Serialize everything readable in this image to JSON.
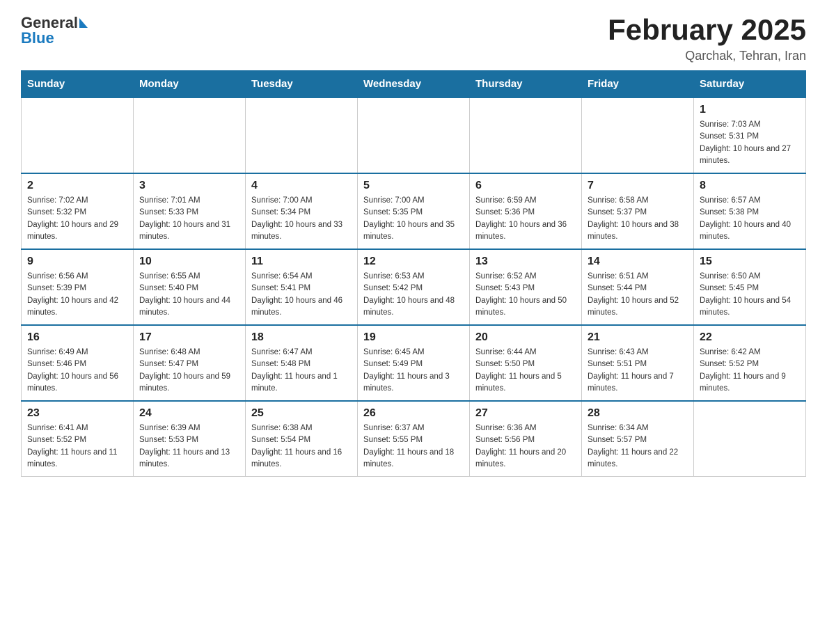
{
  "header": {
    "logo_general": "General",
    "logo_blue": "Blue",
    "month_title": "February 2025",
    "location": "Qarchak, Tehran, Iran"
  },
  "days_of_week": [
    "Sunday",
    "Monday",
    "Tuesday",
    "Wednesday",
    "Thursday",
    "Friday",
    "Saturday"
  ],
  "weeks": [
    {
      "days": [
        {
          "date": "",
          "sunrise": "",
          "sunset": "",
          "daylight": ""
        },
        {
          "date": "",
          "sunrise": "",
          "sunset": "",
          "daylight": ""
        },
        {
          "date": "",
          "sunrise": "",
          "sunset": "",
          "daylight": ""
        },
        {
          "date": "",
          "sunrise": "",
          "sunset": "",
          "daylight": ""
        },
        {
          "date": "",
          "sunrise": "",
          "sunset": "",
          "daylight": ""
        },
        {
          "date": "",
          "sunrise": "",
          "sunset": "",
          "daylight": ""
        },
        {
          "date": "1",
          "sunrise": "Sunrise: 7:03 AM",
          "sunset": "Sunset: 5:31 PM",
          "daylight": "Daylight: 10 hours and 27 minutes."
        }
      ]
    },
    {
      "days": [
        {
          "date": "2",
          "sunrise": "Sunrise: 7:02 AM",
          "sunset": "Sunset: 5:32 PM",
          "daylight": "Daylight: 10 hours and 29 minutes."
        },
        {
          "date": "3",
          "sunrise": "Sunrise: 7:01 AM",
          "sunset": "Sunset: 5:33 PM",
          "daylight": "Daylight: 10 hours and 31 minutes."
        },
        {
          "date": "4",
          "sunrise": "Sunrise: 7:00 AM",
          "sunset": "Sunset: 5:34 PM",
          "daylight": "Daylight: 10 hours and 33 minutes."
        },
        {
          "date": "5",
          "sunrise": "Sunrise: 7:00 AM",
          "sunset": "Sunset: 5:35 PM",
          "daylight": "Daylight: 10 hours and 35 minutes."
        },
        {
          "date": "6",
          "sunrise": "Sunrise: 6:59 AM",
          "sunset": "Sunset: 5:36 PM",
          "daylight": "Daylight: 10 hours and 36 minutes."
        },
        {
          "date": "7",
          "sunrise": "Sunrise: 6:58 AM",
          "sunset": "Sunset: 5:37 PM",
          "daylight": "Daylight: 10 hours and 38 minutes."
        },
        {
          "date": "8",
          "sunrise": "Sunrise: 6:57 AM",
          "sunset": "Sunset: 5:38 PM",
          "daylight": "Daylight: 10 hours and 40 minutes."
        }
      ]
    },
    {
      "days": [
        {
          "date": "9",
          "sunrise": "Sunrise: 6:56 AM",
          "sunset": "Sunset: 5:39 PM",
          "daylight": "Daylight: 10 hours and 42 minutes."
        },
        {
          "date": "10",
          "sunrise": "Sunrise: 6:55 AM",
          "sunset": "Sunset: 5:40 PM",
          "daylight": "Daylight: 10 hours and 44 minutes."
        },
        {
          "date": "11",
          "sunrise": "Sunrise: 6:54 AM",
          "sunset": "Sunset: 5:41 PM",
          "daylight": "Daylight: 10 hours and 46 minutes."
        },
        {
          "date": "12",
          "sunrise": "Sunrise: 6:53 AM",
          "sunset": "Sunset: 5:42 PM",
          "daylight": "Daylight: 10 hours and 48 minutes."
        },
        {
          "date": "13",
          "sunrise": "Sunrise: 6:52 AM",
          "sunset": "Sunset: 5:43 PM",
          "daylight": "Daylight: 10 hours and 50 minutes."
        },
        {
          "date": "14",
          "sunrise": "Sunrise: 6:51 AM",
          "sunset": "Sunset: 5:44 PM",
          "daylight": "Daylight: 10 hours and 52 minutes."
        },
        {
          "date": "15",
          "sunrise": "Sunrise: 6:50 AM",
          "sunset": "Sunset: 5:45 PM",
          "daylight": "Daylight: 10 hours and 54 minutes."
        }
      ]
    },
    {
      "days": [
        {
          "date": "16",
          "sunrise": "Sunrise: 6:49 AM",
          "sunset": "Sunset: 5:46 PM",
          "daylight": "Daylight: 10 hours and 56 minutes."
        },
        {
          "date": "17",
          "sunrise": "Sunrise: 6:48 AM",
          "sunset": "Sunset: 5:47 PM",
          "daylight": "Daylight: 10 hours and 59 minutes."
        },
        {
          "date": "18",
          "sunrise": "Sunrise: 6:47 AM",
          "sunset": "Sunset: 5:48 PM",
          "daylight": "Daylight: 11 hours and 1 minute."
        },
        {
          "date": "19",
          "sunrise": "Sunrise: 6:45 AM",
          "sunset": "Sunset: 5:49 PM",
          "daylight": "Daylight: 11 hours and 3 minutes."
        },
        {
          "date": "20",
          "sunrise": "Sunrise: 6:44 AM",
          "sunset": "Sunset: 5:50 PM",
          "daylight": "Daylight: 11 hours and 5 minutes."
        },
        {
          "date": "21",
          "sunrise": "Sunrise: 6:43 AM",
          "sunset": "Sunset: 5:51 PM",
          "daylight": "Daylight: 11 hours and 7 minutes."
        },
        {
          "date": "22",
          "sunrise": "Sunrise: 6:42 AM",
          "sunset": "Sunset: 5:52 PM",
          "daylight": "Daylight: 11 hours and 9 minutes."
        }
      ]
    },
    {
      "days": [
        {
          "date": "23",
          "sunrise": "Sunrise: 6:41 AM",
          "sunset": "Sunset: 5:52 PM",
          "daylight": "Daylight: 11 hours and 11 minutes."
        },
        {
          "date": "24",
          "sunrise": "Sunrise: 6:39 AM",
          "sunset": "Sunset: 5:53 PM",
          "daylight": "Daylight: 11 hours and 13 minutes."
        },
        {
          "date": "25",
          "sunrise": "Sunrise: 6:38 AM",
          "sunset": "Sunset: 5:54 PM",
          "daylight": "Daylight: 11 hours and 16 minutes."
        },
        {
          "date": "26",
          "sunrise": "Sunrise: 6:37 AM",
          "sunset": "Sunset: 5:55 PM",
          "daylight": "Daylight: 11 hours and 18 minutes."
        },
        {
          "date": "27",
          "sunrise": "Sunrise: 6:36 AM",
          "sunset": "Sunset: 5:56 PM",
          "daylight": "Daylight: 11 hours and 20 minutes."
        },
        {
          "date": "28",
          "sunrise": "Sunrise: 6:34 AM",
          "sunset": "Sunset: 5:57 PM",
          "daylight": "Daylight: 11 hours and 22 minutes."
        },
        {
          "date": "",
          "sunrise": "",
          "sunset": "",
          "daylight": ""
        }
      ]
    }
  ]
}
